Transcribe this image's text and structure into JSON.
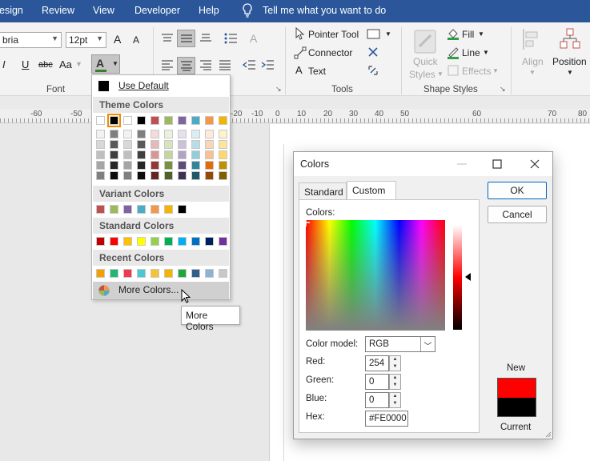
{
  "menubar": {
    "items": [
      "esign",
      "Review",
      "View",
      "Developer",
      "Help"
    ],
    "tell_me": "Tell me what you want to do"
  },
  "ribbon": {
    "font_name": "bria",
    "font_size": "12pt",
    "groups": {
      "font": "Font",
      "tools": "Tools",
      "shape_styles": "Shape Styles"
    },
    "tools": {
      "pointer": "Pointer Tool",
      "connector": "Connector",
      "text": "Text"
    },
    "shape": {
      "quick_styles_1": "Quick",
      "quick_styles_2": "Styles",
      "fill": "Fill",
      "line": "Line",
      "effects": "Effects",
      "align": "Align",
      "position": "Position"
    },
    "buttons": {
      "italic": "I",
      "underline": "U",
      "strikethrough": "abc",
      "change_case": "Aa",
      "font_color": "A",
      "grow_font": "A",
      "shrink_font": "A",
      "text_tool": "A"
    }
  },
  "ruler": {
    "ticks": [
      "-60",
      "-50",
      "-20",
      "-10",
      "0",
      "10",
      "20",
      "30",
      "40",
      "50",
      "60",
      "70",
      "80"
    ]
  },
  "color_dropdown": {
    "use_default": "Use Default",
    "theme_colors_heading": "Theme Colors",
    "variant_colors_heading": "Variant Colors",
    "standard_colors_heading": "Standard Colors",
    "recent_colors_heading": "Recent Colors",
    "more_colors": "More Colors...",
    "theme_top_row": [
      "#ffffff",
      "#000000",
      "#ffffff",
      "#000000",
      "#c0504d",
      "#9bbb59",
      "#8064a2",
      "#4bacc6",
      "#f79646",
      "#f4b400"
    ],
    "theme_shades": [
      [
        "#f2f2f2",
        "#7f7f7f",
        "#f2f2f2",
        "#7f7f7f",
        "#f2dcdb",
        "#ebf1dd",
        "#e5e0ec",
        "#dbeef3",
        "#fdeada",
        "#fff2cc"
      ],
      [
        "#d8d8d8",
        "#595959",
        "#d8d8d8",
        "#595959",
        "#e5b9b7",
        "#d7e3bc",
        "#ccc1d9",
        "#b7dde8",
        "#fbd5b5",
        "#ffe599"
      ],
      [
        "#bfbfbf",
        "#3f3f3f",
        "#bfbfbf",
        "#3f3f3f",
        "#d99694",
        "#c3d69b",
        "#b2a2c7",
        "#92cddc",
        "#fac08f",
        "#ffd966"
      ],
      [
        "#a5a5a5",
        "#262626",
        "#a5a5a5",
        "#262626",
        "#953734",
        "#76923c",
        "#5f497a",
        "#31859b",
        "#e36c09",
        "#bf9000"
      ],
      [
        "#7f7f7f",
        "#0c0c0c",
        "#7f7f7f",
        "#0c0c0c",
        "#632423",
        "#4f6128",
        "#3f3151",
        "#205867",
        "#974806",
        "#7f6000"
      ]
    ],
    "variant_colors": [
      "#c0504d",
      "#9bbb59",
      "#8064a2",
      "#4bacc6",
      "#f79646",
      "#f4b400",
      "#000000"
    ],
    "standard_colors": [
      "#c00000",
      "#ff0000",
      "#ffc000",
      "#ffff00",
      "#92d050",
      "#00b050",
      "#00b0f0",
      "#0070c0",
      "#002060",
      "#7030a0"
    ],
    "recent_colors": [
      "#f4a100",
      "#22b573",
      "#ef3b4f",
      "#4bc8d6",
      "#f7c32e",
      "#f4b400",
      "#1fa83a",
      "#2f5f8a",
      "#8cb4d6",
      "#c8c8c8"
    ]
  },
  "tooltip": {
    "text": "More Colors"
  },
  "colors_dialog": {
    "title": "Colors",
    "tab_standard": "Standard",
    "tab_custom": "Custom",
    "colors_label": "Colors:",
    "color_model_label": "Color model:",
    "color_model_value": "RGB",
    "red_label": "Red:",
    "red_value": "254",
    "green_label": "Green:",
    "green_value": "0",
    "blue_label": "Blue:",
    "blue_value": "0",
    "hex_label": "Hex:",
    "hex_value": "#FE0000",
    "ok": "OK",
    "cancel": "Cancel",
    "new_label": "New",
    "current_label": "Current",
    "new_color": "#fe0000",
    "current_color": "#000000"
  }
}
